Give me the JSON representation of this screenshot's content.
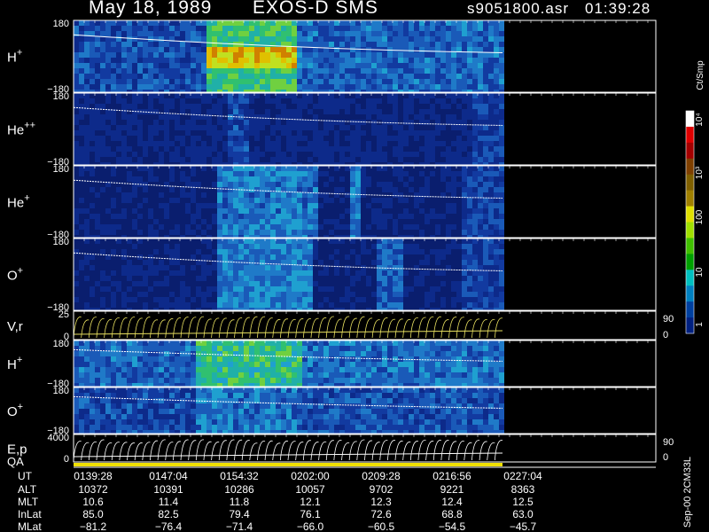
{
  "header": {
    "date": "May 18, 1989",
    "instrument": "EXOS-D SMS",
    "file": "s9051800.asr",
    "time": "01:39:28"
  },
  "chart_data": {
    "type": "heatmap",
    "panels": [
      {
        "label": "H",
        "sup": "+",
        "ymax": "180",
        "ymin": "−180"
      },
      {
        "label": "He",
        "sup": "++",
        "ymax": "180",
        "ymin": "−180"
      },
      {
        "label": "He",
        "sup": "+",
        "ymax": "180",
        "ymin": "−180"
      },
      {
        "label": "O",
        "sup": "+",
        "ymax": "180",
        "ymin": "−180"
      },
      {
        "label": "V,r",
        "sup": "",
        "ymax": "25",
        "ymin": "0",
        "rmax": "90",
        "rmin": "0"
      },
      {
        "label": "H",
        "sup": "+",
        "ymax": "180",
        "ymin": "−180"
      },
      {
        "label": "O",
        "sup": "+",
        "ymax": "180",
        "ymin": "−180"
      },
      {
        "label": "E,p",
        "sup": "",
        "ymax": "4000",
        "ymin": "0",
        "rmax": "90",
        "rmin": "0"
      }
    ],
    "qa_label": "QA",
    "colorbar": {
      "unit": "Ct/Smp",
      "ticks": [
        "10⁴",
        "10³",
        "100",
        "10",
        "1"
      ],
      "colors": [
        "#ffffff",
        "#e00000",
        "#a40000",
        "#804000",
        "#806000",
        "#a08000",
        "#e0e000",
        "#a0e000",
        "#40c000",
        "#00a000",
        "#00c0c0",
        "#0080c0",
        "#0040a0",
        "#002080"
      ]
    },
    "ephemeris": {
      "labels": [
        "UT",
        "ALT",
        "MLT",
        "InLat",
        "MLat"
      ],
      "rows": [
        [
          "0139:28",
          "0147:04",
          "0154:32",
          "0202:00",
          "0209:28",
          "0216:56",
          "0227:04"
        ],
        [
          "10372",
          "10391",
          "10286",
          "10057",
          "9702",
          "9221",
          "8363"
        ],
        [
          "10.6",
          "11.4",
          "11.8",
          "12.1",
          "12.3",
          "12.4",
          "12.5"
        ],
        [
          "85.0",
          "82.5",
          "79.4",
          "76.1",
          "72.6",
          "68.8",
          "63.0"
        ],
        [
          "−81.2",
          "−76.4",
          "−71.4",
          "−66.0",
          "−60.5",
          "−54.5",
          "−45.7"
        ]
      ]
    },
    "side_label": "Sep-00 2CM33L"
  }
}
